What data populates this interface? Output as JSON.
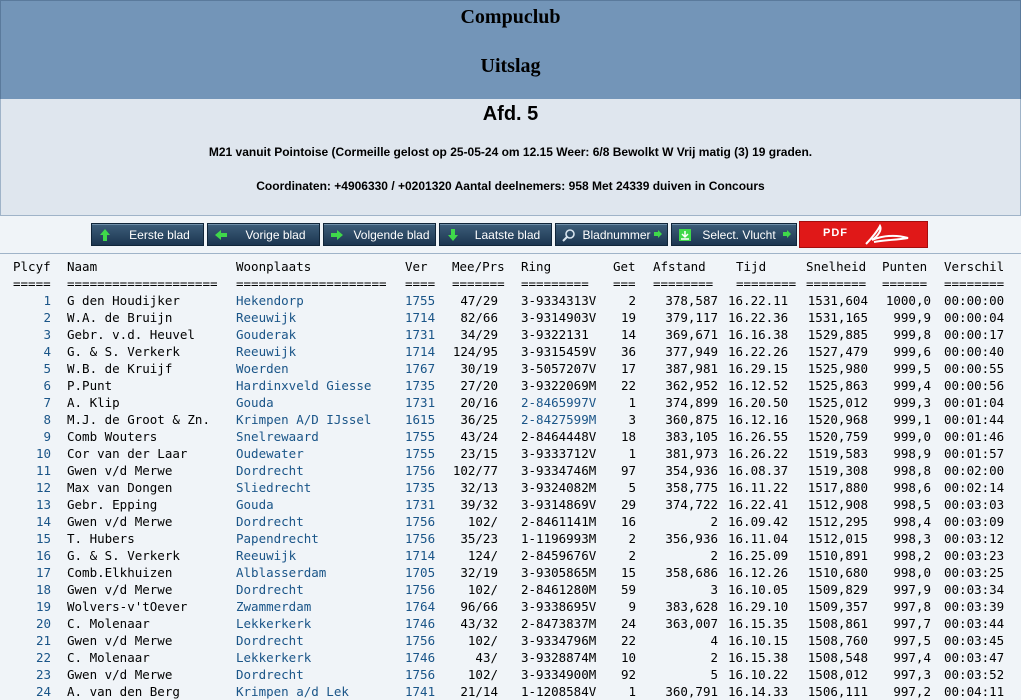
{
  "header": {
    "title": "Compuclub",
    "subtitle": "Uitslag"
  },
  "info": {
    "afdeling": "Afd. 5",
    "line1": "M21 vanuit Pointoise (Cormeille gelost op 25-05-24 om 12.15 Weer: 6/8 Bewolkt W Vrij matig (3) 19 graden.",
    "line2": "Coordinaten: +4906330 / +0201320 Aantal deelnemers: 958 Met 24339 duiven in Concours"
  },
  "nav": {
    "first": "Eerste blad",
    "prev": "Vorige blad",
    "next": "Volgende blad",
    "last": "Laatste blad",
    "pagenum": "Bladnummer",
    "select": "Select. Vlucht",
    "pdf": "PDF"
  },
  "columns": [
    "Plcyf",
    "Naam",
    "Woonplaats",
    "Ver",
    "Mee/Prs",
    "Ring",
    "Get",
    "Afstand",
    "Tijd",
    "Snelheid",
    "Punten",
    "Verschil"
  ],
  "underlines": [
    "=====",
    "====================",
    "====================",
    "====",
    "=======",
    "=========",
    "===",
    "========",
    "========",
    "========",
    "======",
    "========"
  ],
  "rows": [
    [
      "1",
      "G den Houdijker",
      "Hekendorp",
      "1755",
      "47/29",
      "3-9334313V",
      "2",
      "378,587",
      "16.22.11",
      "1531,604",
      "1000,0",
      "00:00:00"
    ],
    [
      "2",
      "W.A. de Bruijn",
      "Reeuwijk",
      "1714",
      "82/66",
      "3-9314903V",
      "19",
      "379,117",
      "16.22.36",
      "1531,165",
      "999,9",
      "00:00:04"
    ],
    [
      "3",
      "Gebr. v.d. Heuvel",
      "Gouderak",
      "1731",
      "34/29",
      "3-9322131",
      "14",
      "369,671",
      "16.16.38",
      "1529,885",
      "999,8",
      "00:00:17"
    ],
    [
      "4",
      "G. & S. Verkerk",
      "Reeuwijk",
      "1714",
      "124/95",
      "3-9315459V",
      "36",
      "377,949",
      "16.22.26",
      "1527,479",
      "999,6",
      "00:00:40"
    ],
    [
      "5",
      "W.B. de Kruijf",
      "Woerden",
      "1767",
      "30/19",
      "3-5057207V",
      "17",
      "387,981",
      "16.29.15",
      "1525,980",
      "999,5",
      "00:00:55"
    ],
    [
      "6",
      "P.Punt",
      "Hardinxveld Giesse",
      "1735",
      "27/20",
      "3-9322069M",
      "22",
      "362,952",
      "16.12.52",
      "1525,863",
      "999,4",
      "00:00:56"
    ],
    [
      "7",
      "A. Klip",
      "Gouda",
      "1731",
      "20/16",
      "2-8465997V",
      "1",
      "374,899",
      "16.20.50",
      "1525,012",
      "999,3",
      "00:01:04"
    ],
    [
      "8",
      "M.J. de Groot & Zn.",
      "Krimpen A/D IJssel",
      "1615",
      "36/25",
      "2-8427599M",
      "3",
      "360,875",
      "16.12.16",
      "1520,968",
      "999,1",
      "00:01:44"
    ],
    [
      "9",
      "Comb Wouters",
      "Snelrewaard",
      "1755",
      "43/24",
      "2-8464448V",
      "18",
      "383,105",
      "16.26.55",
      "1520,759",
      "999,0",
      "00:01:46"
    ],
    [
      "10",
      "Cor van der Laar",
      "Oudewater",
      "1755",
      "23/15",
      "3-9333712V",
      "1",
      "381,973",
      "16.26.22",
      "1519,583",
      "998,9",
      "00:01:57"
    ],
    [
      "11",
      "Gwen v/d Merwe",
      "Dordrecht",
      "1756",
      "102/77",
      "3-9334746M",
      "97",
      "354,936",
      "16.08.37",
      "1519,308",
      "998,8",
      "00:02:00"
    ],
    [
      "12",
      "Max van Dongen",
      "Sliedrecht",
      "1735",
      "32/13",
      "3-9324082M",
      "5",
      "358,775",
      "16.11.22",
      "1517,880",
      "998,6",
      "00:02:14"
    ],
    [
      "13",
      "Gebr. Epping",
      "Gouda",
      "1731",
      "39/32",
      "3-9314869V",
      "29",
      "374,722",
      "16.22.41",
      "1512,908",
      "998,5",
      "00:03:03"
    ],
    [
      "14",
      "Gwen v/d Merwe",
      "Dordrecht",
      "1756",
      "102/",
      "2-8461141M",
      "16",
      "2",
      "16.09.42",
      "1512,295",
      "998,4",
      "00:03:09"
    ],
    [
      "15",
      "T. Hubers",
      "Papendrecht",
      "1756",
      "35/23",
      "1-1196993M",
      "2",
      "356,936",
      "16.11.04",
      "1512,015",
      "998,3",
      "00:03:12"
    ],
    [
      "16",
      "G. & S. Verkerk",
      "Reeuwijk",
      "1714",
      "124/",
      "2-8459676V",
      "2",
      "2",
      "16.25.09",
      "1510,891",
      "998,2",
      "00:03:23"
    ],
    [
      "17",
      "Comb.Elkhuizen",
      "Alblasserdam",
      "1705",
      "32/19",
      "3-9305865M",
      "15",
      "358,686",
      "16.12.26",
      "1510,680",
      "998,0",
      "00:03:25"
    ],
    [
      "18",
      "Gwen v/d Merwe",
      "Dordrecht",
      "1756",
      "102/",
      "2-8461280M",
      "59",
      "3",
      "16.10.05",
      "1509,829",
      "997,9",
      "00:03:34"
    ],
    [
      "19",
      "Wolvers-v'tOever",
      "Zwammerdam",
      "1764",
      "96/66",
      "3-9338695V",
      "9",
      "383,628",
      "16.29.10",
      "1509,357",
      "997,8",
      "00:03:39"
    ],
    [
      "20",
      "C. Molenaar",
      "Lekkerkerk",
      "1746",
      "43/32",
      "2-8473837M",
      "24",
      "363,007",
      "16.15.35",
      "1508,861",
      "997,7",
      "00:03:44"
    ],
    [
      "21",
      "Gwen v/d Merwe",
      "Dordrecht",
      "1756",
      "102/",
      "3-9334796M",
      "22",
      "4",
      "16.10.15",
      "1508,760",
      "997,5",
      "00:03:45"
    ],
    [
      "22",
      "C. Molenaar",
      "Lekkerkerk",
      "1746",
      "43/",
      "3-9328874M",
      "10",
      "2",
      "16.15.38",
      "1508,548",
      "997,4",
      "00:03:47"
    ],
    [
      "23",
      "Gwen v/d Merwe",
      "Dordrecht",
      "1756",
      "102/",
      "3-9334900M",
      "92",
      "5",
      "16.10.22",
      "1508,012",
      "997,3",
      "00:03:52"
    ],
    [
      "24",
      "A. van den Berg",
      "Krimpen a/d Lek",
      "1741",
      "21/14",
      "1-1208584V",
      "1",
      "360,791",
      "16.14.33",
      "1506,111",
      "997,2",
      "00:04:11"
    ]
  ]
}
